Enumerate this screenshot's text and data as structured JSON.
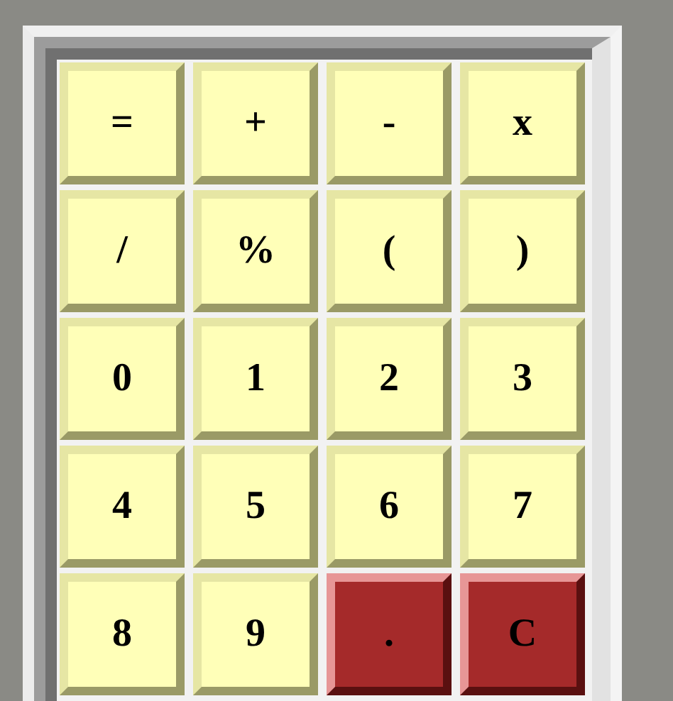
{
  "keys": [
    {
      "label": "=",
      "kind": "plain"
    },
    {
      "label": "+",
      "kind": "plain"
    },
    {
      "label": "-",
      "kind": "plain"
    },
    {
      "label": "x",
      "kind": "plain"
    },
    {
      "label": "/",
      "kind": "plain"
    },
    {
      "label": "%",
      "kind": "plain"
    },
    {
      "label": "(",
      "kind": "plain"
    },
    {
      "label": ")",
      "kind": "plain"
    },
    {
      "label": "0",
      "kind": "plain"
    },
    {
      "label": "1",
      "kind": "plain"
    },
    {
      "label": "2",
      "kind": "plain"
    },
    {
      "label": "3",
      "kind": "plain"
    },
    {
      "label": "4",
      "kind": "plain"
    },
    {
      "label": "5",
      "kind": "plain"
    },
    {
      "label": "6",
      "kind": "plain"
    },
    {
      "label": "7",
      "kind": "plain"
    },
    {
      "label": "8",
      "kind": "plain"
    },
    {
      "label": "9",
      "kind": "plain"
    },
    {
      "label": ".",
      "kind": "accent"
    },
    {
      "label": "C",
      "kind": "accent"
    }
  ]
}
